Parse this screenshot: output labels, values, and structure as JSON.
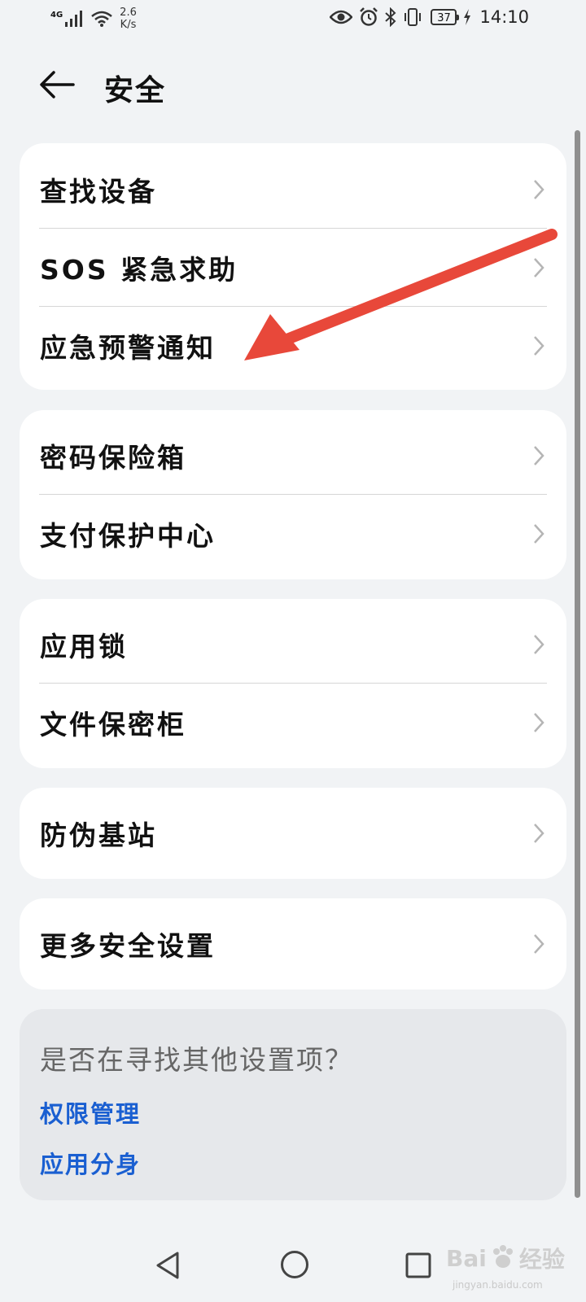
{
  "status_bar": {
    "network": "4G",
    "speed_value": "2.6",
    "speed_unit": "K/s",
    "battery": "37",
    "time": "14:10",
    "icons": [
      "signal-icon",
      "wifi-icon",
      "eye-icon",
      "alarm-icon",
      "bluetooth-icon",
      "vibrate-icon",
      "battery-icon",
      "charging-icon"
    ]
  },
  "header": {
    "title": "安全",
    "back_icon": "back-arrow-icon"
  },
  "groups": [
    {
      "items": [
        "查找设备",
        "SOS 紧急求助",
        "应急预警通知"
      ]
    },
    {
      "items": [
        "密码保险箱",
        "支付保护中心"
      ]
    },
    {
      "items": [
        "应用锁",
        "文件保密柜"
      ]
    },
    {
      "items": [
        "防伪基站"
      ]
    },
    {
      "items": [
        "更多安全设置"
      ]
    }
  ],
  "suggest": {
    "title": "是否在寻找其他设置项？",
    "links": [
      "权限管理",
      "应用分身"
    ]
  },
  "annotation": {
    "color": "#e8483a"
  },
  "watermark": {
    "brand_a": "Bai",
    "brand_b": "经验",
    "url": "jingyan.baidu.com"
  },
  "colors": {
    "link": "#1a5fd1",
    "background": "#f1f3f5",
    "card": "#ffffff"
  }
}
